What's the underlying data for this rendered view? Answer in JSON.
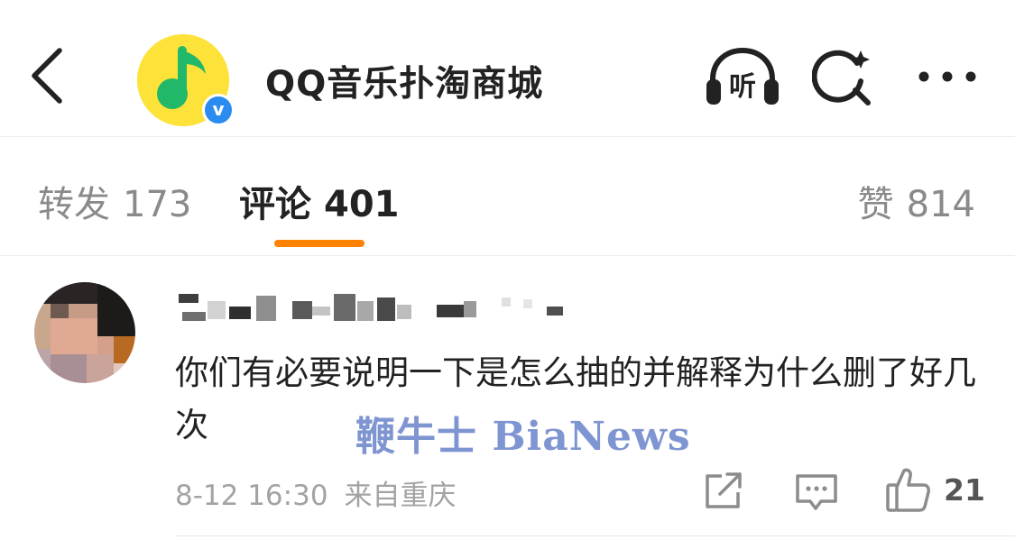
{
  "header": {
    "account_name": "QQ音乐扑淘商城",
    "verified_badge": "v",
    "listen_label": "听",
    "icons": [
      "back-icon",
      "listen-icon",
      "search-icon",
      "more-icon"
    ]
  },
  "tabs": {
    "forward": {
      "label": "转发",
      "count": "173"
    },
    "comment": {
      "label": "评论",
      "count": "401",
      "active": true
    },
    "like": {
      "label": "赞",
      "count": "814"
    },
    "accent_color": "#ff8200"
  },
  "comment": {
    "text": "你们有必要说明一下是怎么抽的并解释为什么删了好几次",
    "time": "8-12 16:30",
    "location": "来自重庆",
    "like_count": "21"
  },
  "watermark": "鞭牛士 BiaNews"
}
